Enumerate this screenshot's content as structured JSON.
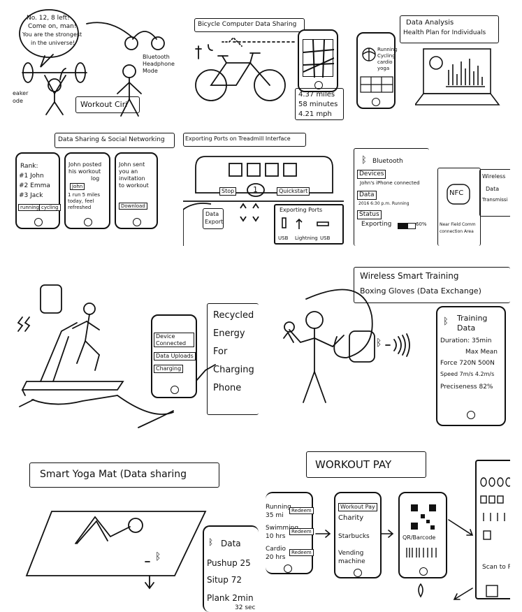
{
  "p1": {
    "speech": [
      "No. 12, 8 left!",
      "Come on, man!",
      "You are the strongest",
      "in the universe!"
    ],
    "headphone_mode": [
      "Bluetooth",
      "Headphone",
      "Mode"
    ],
    "speaker_mode": [
      "eaker",
      "ode"
    ],
    "workout_label": "Workout Ciri"
  },
  "p2": {
    "title": "Bicycle Computer Data Sharing",
    "stats": [
      "4.37 miles",
      "58 minutes",
      "4.21 mph"
    ]
  },
  "p3": {
    "title": [
      "Data Analysis",
      "Health Plan for Individuals"
    ],
    "checklist": [
      "Running",
      "Cycling",
      "cardio",
      "yoga"
    ]
  },
  "p4": {
    "title": "Data Sharing & Social Networking",
    "rank": [
      "Rank:",
      "#1 John",
      "#2 Emma",
      "#3 Jack"
    ],
    "rank_tabs": [
      "running",
      "cycling"
    ],
    "post": [
      "John posted",
      "his workout",
      "log"
    ],
    "post_chip": "John",
    "post_detail": [
      "1 run 5 miles",
      "today, feel",
      "refreshed"
    ],
    "invite": [
      "John sent",
      "you an",
      "invitation",
      "to workout"
    ],
    "download": "Download"
  },
  "p5": {
    "title": "Exporting Ports on Treadmill Interface",
    "stop": "Stop",
    "count": "1",
    "quickstart": "Quickstart",
    "data_export": [
      "Data",
      "Export"
    ],
    "ports_title": "Exporting Ports",
    "ports": [
      "USB",
      "Lightning",
      "USB"
    ]
  },
  "p6": {
    "bluetooth": "Bluetooth",
    "devices": "Devices",
    "connected": "John's iPhone connected",
    "data": "Data",
    "data_detail": "2016 6:30 p.m. Running",
    "status": "Status",
    "exporting": "Exporting",
    "pct": "60%",
    "nfc": "NFC",
    "nfc_caption": [
      "Near Field Comm",
      "connection Area"
    ],
    "wireless": [
      "Wireless",
      "Data",
      "Transmissi"
    ]
  },
  "p7": {
    "phone_items": [
      "Device Connected",
      "Data Uploads",
      "Charging"
    ],
    "recycled": [
      "Recycled",
      "Energy",
      "For",
      "Charging",
      "Phone"
    ]
  },
  "p8": {
    "title": [
      "Wireless Smart Training",
      "Boxing Gloves (Data Exchange)"
    ],
    "training": [
      "Training",
      "Data"
    ],
    "duration": "Duration: 35min",
    "max_mean": "Max Mean",
    "force": "Force 720N 500N",
    "speed": "Speed 7m/s 4.2m/s",
    "precision": "Preciseness 82%"
  },
  "p9": {
    "title": "Smart Yoga Mat (Data sharing",
    "data_title": "Data",
    "rows": [
      "Pushup 25",
      "Situp 72",
      "Plank 2min"
    ],
    "extra": "32 sec"
  },
  "p10": {
    "title": "WORKOUT PAY",
    "list": [
      {
        "a": "Running",
        "b": "35 mi",
        "btn": "Redeem"
      },
      {
        "a": "Swimming",
        "b": "10 hrs",
        "btn": "Redeem"
      },
      {
        "a": "Cardio",
        "b": "20 hrs",
        "btn": "Redeem"
      }
    ],
    "pay": [
      "Workout Pay",
      "Charity",
      "Starbucks",
      "Vending",
      "machine"
    ],
    "qr": "QR/Barcode",
    "scan": "Scan to P"
  }
}
